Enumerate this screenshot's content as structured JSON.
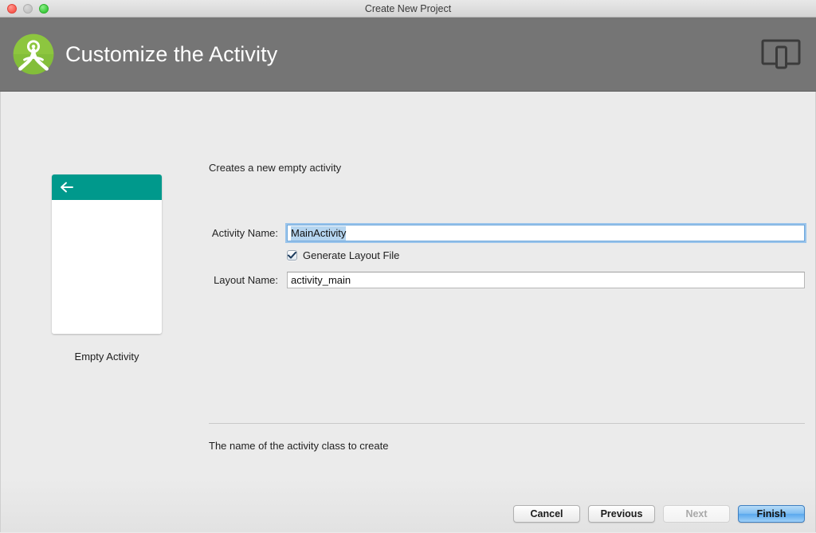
{
  "window": {
    "title": "Create New Project",
    "traffic_lights": [
      "close",
      "minimize",
      "maximize"
    ]
  },
  "header": {
    "title": "Customize the Activity",
    "logo_icon": "android-studio-logo-icon",
    "device_icon": "device-preview-icon",
    "background_color": "#757575"
  },
  "preview": {
    "caption": "Empty Activity",
    "appbar_color": "#00998c",
    "back_icon": "back-arrow-icon"
  },
  "main": {
    "description": "Creates a new empty activity",
    "fields": {
      "activity_name": {
        "label": "Activity Name:",
        "value": "MainActivity",
        "selected": true,
        "focused": true
      },
      "layout_name": {
        "label": "Layout Name:",
        "value": "activity_main",
        "selected": false,
        "focused": false
      }
    },
    "checkbox": {
      "label": "Generate Layout File",
      "checked": true
    },
    "help_text": "The name of the activity class to create"
  },
  "footer": {
    "buttons": [
      {
        "label": "Cancel",
        "state": "normal"
      },
      {
        "label": "Previous",
        "state": "normal"
      },
      {
        "label": "Next",
        "state": "disabled"
      },
      {
        "label": "Finish",
        "state": "default"
      }
    ]
  },
  "colors": {
    "accent_blue": "#5aa8ee",
    "teal": "#00998c",
    "header_grey": "#757575",
    "selection_blue": "#b5d5f0",
    "background": "#ebebeb"
  }
}
